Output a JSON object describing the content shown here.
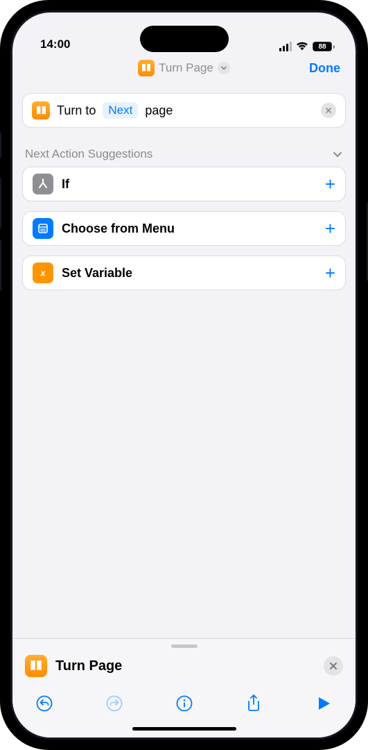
{
  "status": {
    "time": "14:00",
    "battery": "88"
  },
  "nav": {
    "title": "Turn Page",
    "done": "Done"
  },
  "action": {
    "prefix": "Turn to",
    "param": "Next",
    "suffix": "page"
  },
  "suggestions": {
    "heading": "Next Action Suggestions",
    "items": [
      {
        "label": "If"
      },
      {
        "label": "Choose from Menu"
      },
      {
        "label": "Set Variable"
      }
    ]
  },
  "bottom": {
    "title": "Turn Page"
  }
}
